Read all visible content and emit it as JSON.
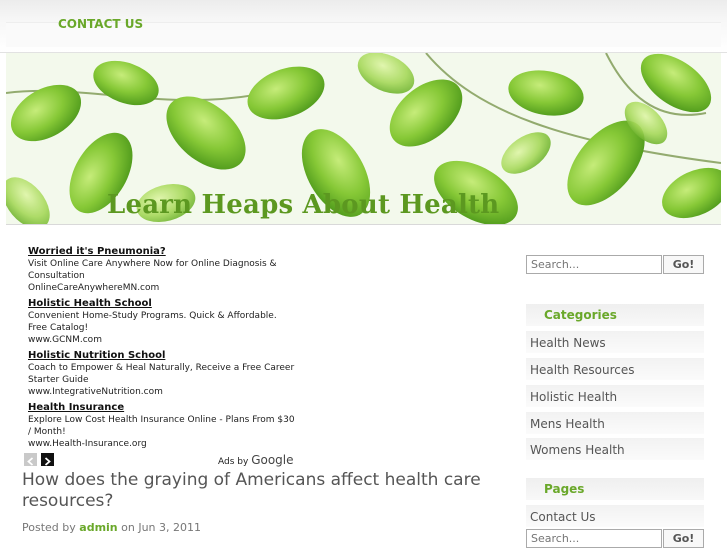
{
  "nav": {
    "contact_label": "CONTACT US"
  },
  "header": {
    "site_title": "Learn Heaps About Health"
  },
  "ads": [
    {
      "title": "Worried it's Pneumonia?",
      "desc": "Visit Online Care Anywhere Now for Online Diagnosis & Consultation",
      "url": "OnlineCareAnywhereMN.com"
    },
    {
      "title": "Holistic Health School",
      "desc": "Convenient Home-Study Programs. Quick & Affordable. Free Catalog!",
      "url": "www.GCNM.com"
    },
    {
      "title": "Holistic Nutrition School",
      "desc": "Coach to Empower & Heal Naturally, Receive a Free Career Starter Guide",
      "url": "www.IntegrativeNutrition.com"
    },
    {
      "title": "Health Insurance",
      "desc": "Explore Low Cost Health Insurance Online - Plans From $30 / Month!",
      "url": "www.Health-Insurance.org"
    }
  ],
  "ads_by": {
    "prefix": "Ads by",
    "brand": "Google"
  },
  "post": {
    "title": "How does the graying of Americans affect health care resources?",
    "posted_by": "Posted by",
    "author": "admin",
    "date": "on Jun 3, 2011"
  },
  "sidebar": {
    "search_placeholder": "Search...",
    "search_button": "Go!",
    "categories_title": "Categories",
    "categories": [
      "Health News",
      "Health Resources",
      "Holistic Health",
      "Mens Health",
      "Womens Health"
    ],
    "pages_title": "Pages",
    "pages": [
      "Contact Us"
    ]
  },
  "colors": {
    "accent": "#6aa82a",
    "title_green": "#5c9820",
    "leaf": "#7dc12f"
  }
}
